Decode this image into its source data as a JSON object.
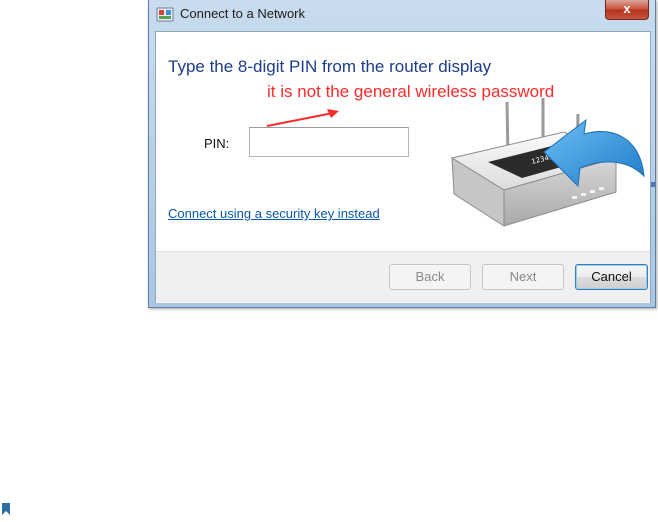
{
  "window": {
    "title": "Connect to a Network",
    "close_label": "x"
  },
  "content": {
    "heading": "Type the 8-digit PIN from the router display",
    "note": "it is not the general wireless password",
    "pin_label": "PIN:",
    "pin_value": "",
    "link_text": "Connect using a security key instead"
  },
  "buttons": {
    "back": "Back",
    "next": "Next",
    "cancel": "Cancel"
  },
  "router": {
    "display_text": "12345678"
  },
  "colors": {
    "heading": "#1e3c8c",
    "note": "#ff2b2b",
    "link": "#0a58a6",
    "arrow_blue": "#2e8fd6"
  },
  "icons": [
    "network-wizard-icon",
    "close-icon",
    "router-icon",
    "bookmark-icon"
  ]
}
